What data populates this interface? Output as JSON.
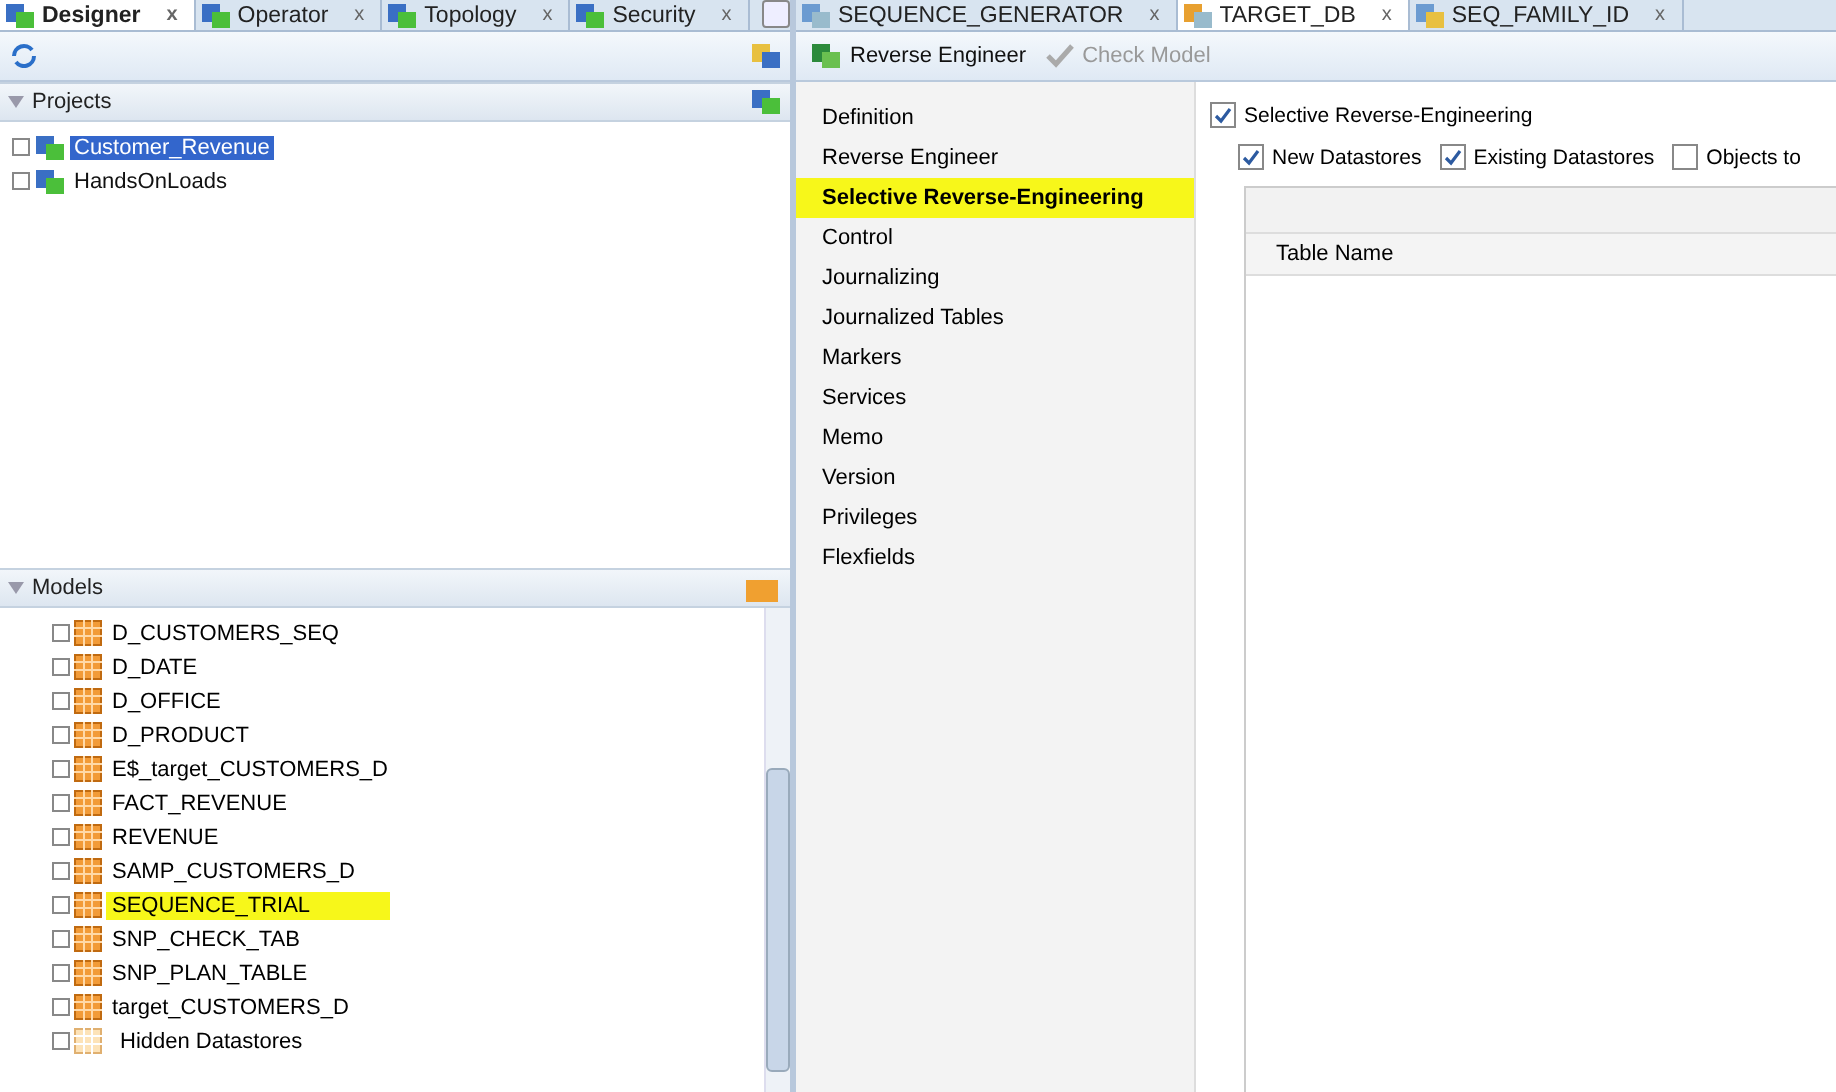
{
  "left_tabs": [
    {
      "label": "Designer",
      "close": "x",
      "selected": true
    },
    {
      "label": "Operator",
      "close": "x",
      "selected": false
    },
    {
      "label": "Topology",
      "close": "x",
      "selected": false
    },
    {
      "label": "Security",
      "close": "x",
      "selected": false
    }
  ],
  "projects": {
    "title": "Projects",
    "items": [
      {
        "label": "Customer_Revenue",
        "selected": true
      },
      {
        "label": "HandsOnLoads",
        "selected": false
      }
    ]
  },
  "models": {
    "title": "Models",
    "items": [
      {
        "label": "D_CUSTOMERS_SEQ",
        "highlighted": false,
        "kind": "table"
      },
      {
        "label": "D_DATE",
        "highlighted": false,
        "kind": "table"
      },
      {
        "label": "D_OFFICE",
        "highlighted": false,
        "kind": "table"
      },
      {
        "label": "D_PRODUCT",
        "highlighted": false,
        "kind": "table"
      },
      {
        "label": "E$_target_CUSTOMERS_D",
        "highlighted": false,
        "kind": "table"
      },
      {
        "label": "FACT_REVENUE",
        "highlighted": false,
        "kind": "table"
      },
      {
        "label": "REVENUE",
        "highlighted": false,
        "kind": "table"
      },
      {
        "label": "SAMP_CUSTOMERS_D",
        "highlighted": false,
        "kind": "table"
      },
      {
        "label": "SEQUENCE_TRIAL",
        "highlighted": true,
        "kind": "table"
      },
      {
        "label": "SNP_CHECK_TAB",
        "highlighted": false,
        "kind": "table"
      },
      {
        "label": "SNP_PLAN_TABLE",
        "highlighted": false,
        "kind": "table"
      },
      {
        "label": "target_CUSTOMERS_D",
        "highlighted": false,
        "kind": "table"
      },
      {
        "label": "Hidden Datastores",
        "highlighted": false,
        "kind": "hidden"
      }
    ]
  },
  "right_tabs": [
    {
      "label": "SEQUENCE_GENERATOR",
      "close": "x",
      "selected": false
    },
    {
      "label": "TARGET_DB",
      "close": "x",
      "selected": true
    },
    {
      "label": "SEQ_FAMILY_ID",
      "close": "x",
      "selected": false
    }
  ],
  "toolbar": [
    {
      "label": "Reverse Engineer",
      "disabled": false
    },
    {
      "label": "Check Model",
      "disabled": true
    }
  ],
  "nav": [
    {
      "label": "Definition",
      "selected": false,
      "highlighted": false
    },
    {
      "label": "Reverse Engineer",
      "selected": false,
      "highlighted": false
    },
    {
      "label": "Selective Reverse-Engineering",
      "selected": true,
      "highlighted": true
    },
    {
      "label": "Control",
      "selected": false,
      "highlighted": false
    },
    {
      "label": "Journalizing",
      "selected": false,
      "highlighted": false
    },
    {
      "label": "Journalized Tables",
      "selected": false,
      "highlighted": false
    },
    {
      "label": "Markers",
      "selected": false,
      "highlighted": false
    },
    {
      "label": "Services",
      "selected": false,
      "highlighted": false
    },
    {
      "label": "Memo",
      "selected": false,
      "highlighted": false
    },
    {
      "label": "Version",
      "selected": false,
      "highlighted": false
    },
    {
      "label": "Privileges",
      "selected": false,
      "highlighted": false
    },
    {
      "label": "Flexfields",
      "selected": false,
      "highlighted": false
    }
  ],
  "selective": {
    "label": "Selective Reverse-Engineering",
    "checked": true
  },
  "options": [
    {
      "label": "New Datastores",
      "checked": true
    },
    {
      "label": "Existing Datastores",
      "checked": true
    },
    {
      "label": "Objects to",
      "checked": false
    }
  ],
  "table": {
    "columns": [
      "Table Name"
    ]
  }
}
